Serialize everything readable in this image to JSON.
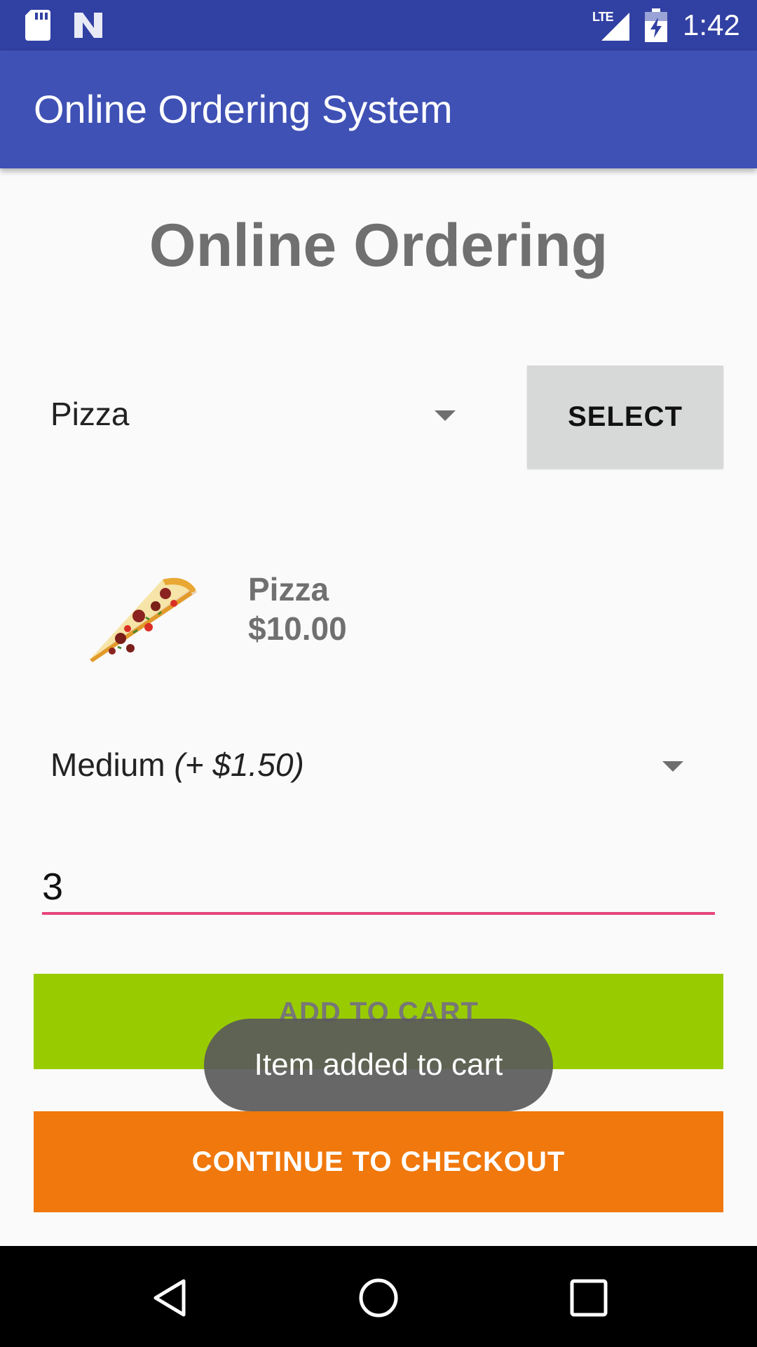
{
  "status_bar": {
    "time": "1:42",
    "network": "LTE"
  },
  "toolbar": {
    "title": "Online Ordering System"
  },
  "page": {
    "heading": "Online Ordering"
  },
  "item_spinner": {
    "selected": "Pizza"
  },
  "select_button": {
    "label": "SELECT"
  },
  "product": {
    "name": "Pizza",
    "price": "$10.00",
    "image_icon": "pizza-slice-icon"
  },
  "size_spinner": {
    "selected": "Medium",
    "extra": "(+ $1.50)"
  },
  "quantity": {
    "value": "3"
  },
  "buttons": {
    "add_to_cart": "ADD TO CART",
    "checkout": "CONTINUE TO CHECKOUT"
  },
  "toast": {
    "message": "Item added to cart"
  },
  "colors": {
    "status_bar": "#3140a3",
    "toolbar": "#3f51b5",
    "add_to_cart": "#99cc00",
    "checkout": "#f0780c",
    "input_underline": "#e8467d"
  }
}
